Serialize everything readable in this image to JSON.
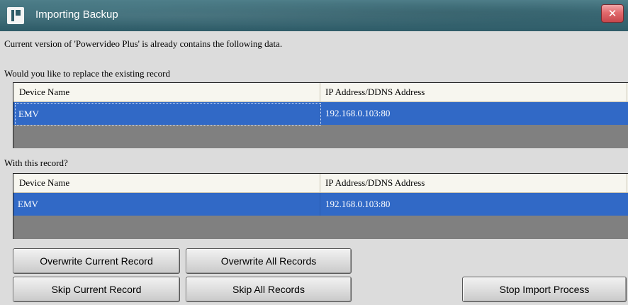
{
  "window": {
    "title": "Importing Backup",
    "close_symbol": "✕"
  },
  "messages": {
    "intro": "Current version of 'Powervideo Plus' is already contains the following data.",
    "replace_question": "Would you like to replace the existing record",
    "with_question": "With this record?"
  },
  "existing_table": {
    "columns": [
      "Device Name",
      "IP Address/DDNS Address"
    ],
    "rows": [
      {
        "device_name": "EMV",
        "address": "192.168.0.103:80"
      }
    ]
  },
  "new_table": {
    "columns": [
      "Device Name",
      "IP Address/DDNS Address"
    ],
    "rows": [
      {
        "device_name": "EMV",
        "address": "192.168.0.103:80"
      }
    ]
  },
  "buttons": {
    "overwrite_current": "Overwrite Current Record",
    "overwrite_all": "Overwrite All Records",
    "skip_current": "Skip Current Record",
    "skip_all": "Skip All Records",
    "stop_import": "Stop Import Process"
  },
  "colors": {
    "title_bar": "#3e6f7b",
    "selection": "#3169c6",
    "grid_empty": "#808080",
    "close_button": "#e26a6d"
  },
  "icons": {
    "app": "app-logo-icon",
    "close": "close-icon"
  }
}
